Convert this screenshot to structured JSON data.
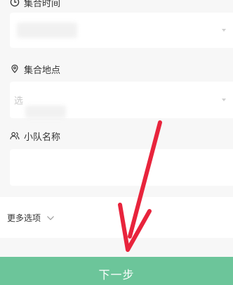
{
  "form": {
    "time": {
      "label": "集合时间",
      "value": "",
      "icon": "clock-icon"
    },
    "place": {
      "label": "集合地点",
      "value": "选",
      "icon": "location-pin-icon"
    },
    "team": {
      "label": "小队名称",
      "value": "",
      "icon": "people-icon"
    }
  },
  "more_options": {
    "label": "更多选项",
    "icon": "chevron-down-icon"
  },
  "next_button": {
    "label": "下一步",
    "color": "#6cc59a"
  },
  "annotation": {
    "arrow_color": "#e8243c",
    "icon": "red-arrow-annotation"
  }
}
